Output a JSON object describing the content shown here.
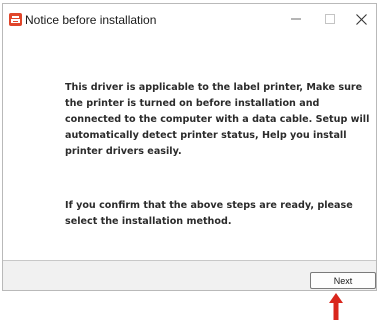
{
  "window": {
    "title": "Notice before installation",
    "controls": {
      "minimize": "—",
      "maximize": "☐",
      "close": "✕"
    }
  },
  "content": {
    "paragraph1": "This driver is applicable to the label printer, Make sure the printer is turned on before installation and connected to the computer with a data cable. Setup will automatically detect printer status, Help you install printer drivers easily.",
    "paragraph2": "If you confirm that the above steps are ready, please select the installation method."
  },
  "footer": {
    "next_label": "Next"
  },
  "colors": {
    "accent_icon": "#e0452a",
    "annotation_arrow": "#d9261c",
    "footer_bg": "#f1f1f1"
  },
  "icons": {
    "app": "printer-app-icon",
    "annotation": "red-up-arrow-icon"
  }
}
